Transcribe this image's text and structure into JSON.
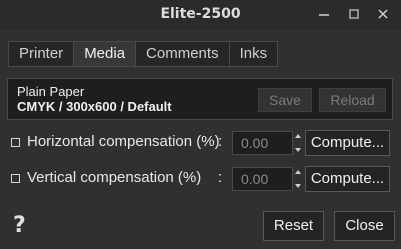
{
  "window": {
    "title": "Elite-2500"
  },
  "tabs": [
    {
      "label": "Printer"
    },
    {
      "label": "Media"
    },
    {
      "label": "Comments"
    },
    {
      "label": "Inks"
    }
  ],
  "media_panel": {
    "name": "Plain Paper",
    "description": "CMYK / 300x600 / Default",
    "save_label": "Save",
    "reload_label": "Reload"
  },
  "compensation": {
    "horizontal": {
      "label": "Horizontal compensation (%)",
      "separator": ":",
      "value": "0.00",
      "compute_label": "Compute...",
      "checked": false
    },
    "vertical": {
      "label": "Vertical compensation (%)",
      "separator": ":",
      "value": "0.00",
      "compute_label": "Compute...",
      "checked": false
    }
  },
  "footer": {
    "help_label": "?",
    "reset_label": "Reset",
    "close_label": "Close"
  }
}
